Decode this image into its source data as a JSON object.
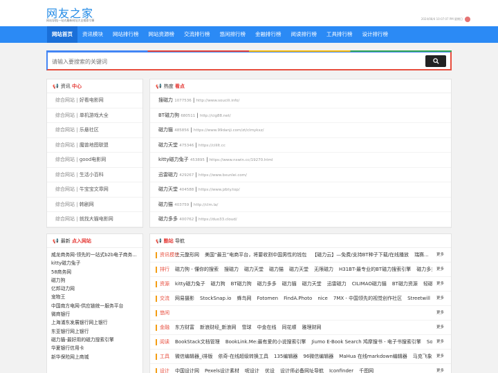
{
  "header": {
    "logo": "网友之家",
    "slogan": "网站导航|一站式最新网址大全搜索引擎",
    "datetime": "2024/08/4 10:07:07 PM 星期日"
  },
  "nav": [
    "网站首页",
    "资讯模块",
    "网站排行榜",
    "网站资源榜",
    "交流排行榜",
    "悠闲排行榜",
    "金融排行榜",
    "阅读排行榜",
    "工具排行榜",
    "设计排行榜"
  ],
  "search": {
    "placeholder": "请输入要搜索的关键词"
  },
  "news": {
    "title_a": "资讯",
    "title_b": "中心",
    "items": [
      {
        "cat": "综合网站",
        "name": "好看电影网"
      },
      {
        "cat": "综合网站",
        "name": "单机游戏大全"
      },
      {
        "cat": "综合网站",
        "name": "乐悬社区"
      },
      {
        "cat": "综合网站",
        "name": "魔兽地图联盟"
      },
      {
        "cat": "综合网站",
        "name": "good电影网"
      },
      {
        "cat": "综合网站",
        "name": "生活小百科"
      },
      {
        "cat": "综合网站",
        "name": "牛宝宝文章网"
      },
      {
        "cat": "综合网站",
        "name": "韩剧网"
      },
      {
        "cat": "综合网站",
        "name": "就找大猫电影网"
      }
    ]
  },
  "hot": {
    "title_a": "热度",
    "title_b": "看点",
    "items": [
      {
        "name": "搜磁力",
        "num": "1077536",
        "url": "http://www.soucili.info/"
      },
      {
        "name": "BT磁力狗",
        "num": "680511",
        "url": "http://cig88.net/"
      },
      {
        "name": "磁力猫",
        "num": "485856",
        "url": "https://www.99danji.com/zt/clmykxz/"
      },
      {
        "name": "磁力天堂",
        "num": "475346",
        "url": "https://cililt.cc"
      },
      {
        "name": "kitty磁力兔子",
        "num": "453895",
        "url": "https://www.nswin.cc/19270.html"
      },
      {
        "name": "迅雷磁力",
        "num": "429267",
        "url": "https://www.bxunlei.com/"
      },
      {
        "name": "磁力天堂",
        "num": "404588",
        "url": "https://www.jzbty.top/"
      },
      {
        "name": "磁力猫",
        "num": "403759",
        "url": "http://clm.la/"
      },
      {
        "name": "磁力多多",
        "num": "400762",
        "url": "https://duo33.cloud/"
      }
    ]
  },
  "latest": {
    "title_a": "最新",
    "title_b": "点入网站",
    "items": [
      "威龙商务网-领先的一站式b2b电子商务...",
      "kitty磁力兔子",
      "58商务网",
      "磁力狗",
      "亿邦动力网",
      "宠物王",
      "中国南方电网-供应链统一服务平台",
      "微商银行",
      "上海浦东发展银行网上银行",
      "东亚银行网上银行",
      "磁力猫-最好用的磁力搜索引擎",
      "华夏银行信用卡",
      "新华保险网上商城"
    ]
  },
  "guide": {
    "title_a": "酷站",
    "title_b": "导航",
    "more": "更多",
    "rows": [
      {
        "cat": "资讯模块",
        "links": [
          "三元整形网",
          "美国“最丑”电商平台，将要收割中国男性的钱包",
          "【磁力云】—免费/支持BT种子下载/在线播放",
          "瑞赛..."
        ]
      },
      {
        "cat": "排行",
        "links": [
          "磁力狗 - 懂你的搜索",
          "搜磁力",
          "磁力天堂",
          "磁力猫",
          "磁力天堂",
          "无限磁力",
          "H31BT-最专业的BT磁力搜索引擎",
          "磁力多多"
        ]
      },
      {
        "cat": "资源",
        "links": [
          "kitty磁力兔子",
          "磁力狗",
          "BT磁力狗",
          "磁力多多",
          "磁力猫",
          "磁力天堂",
          "迅雷磁力",
          "CILIMAO磁力猫",
          "BT磁力资源",
          "轻磁力聚合"
        ]
      },
      {
        "cat": "交流",
        "links": [
          "网易摄影",
          "StockSnap.io",
          "蜂鸟网",
          "Fotomen",
          "FindA.Photo",
          "nice",
          "7MX - 中国领先的视觉创作社区",
          "Streetwill",
          "POCO"
        ]
      },
      {
        "cat": "悠闲",
        "links": []
      },
      {
        "cat": "金融",
        "links": [
          "东方财富",
          "新浪财经_新浪网",
          "雪球",
          "中金在线",
          "同花顺",
          "雅理财网"
        ]
      },
      {
        "cat": "阅读",
        "links": [
          "BookStack文档管理",
          "BookLink.Me:最有爱的小说搜索引擎",
          "Jiumo E-Book Search 鸠摩搜书 - 电子书搜索引擎",
          "SoShu..."
        ]
      },
      {
        "cat": "工具",
        "links": [
          "微信编辑器_i排版",
          "依奇-在线超级转换工具",
          "135编辑器",
          "96微信编辑器",
          "MaHua 在线markdown编辑器",
          "马克飞象",
          "微..."
        ]
      },
      {
        "cat": "设计",
        "links": [
          "中国设计网",
          "Pexels设计素材",
          "呢设计",
          "优设",
          "设计师必备网址导航",
          "Iconfinder",
          "千图网"
        ]
      }
    ]
  }
}
